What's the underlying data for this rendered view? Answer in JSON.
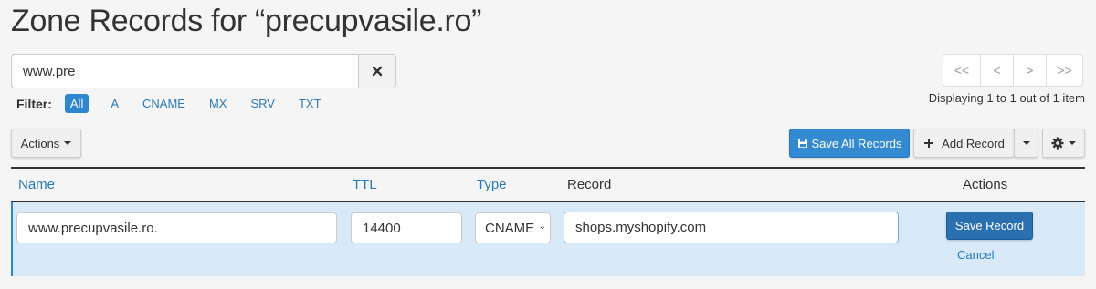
{
  "header": {
    "title": "Zone Records for “precupvasile.ro”"
  },
  "search": {
    "value": "www.pre",
    "clear_icon": "close-icon"
  },
  "pagination": {
    "first": "<<",
    "prev": "<",
    "next": ">",
    "last": ">>",
    "summary": "Displaying 1 to 1 out of 1 item"
  },
  "filter": {
    "label": "Filter:",
    "items": [
      "All",
      "A",
      "CNAME",
      "MX",
      "SRV",
      "TXT"
    ],
    "active": "All"
  },
  "toolbar": {
    "actions_label": "Actions",
    "save_all_label": "Save All Records",
    "save_all_icon": "save-icon",
    "add_record_label": "Add Record",
    "add_record_icon": "plus-icon",
    "settings_icon": "gear-icon"
  },
  "table": {
    "headers": {
      "name": "Name",
      "ttl": "TTL",
      "type": "Type",
      "record": "Record",
      "actions": "Actions"
    },
    "rows": [
      {
        "name": "www.precupvasile.ro.",
        "ttl": "14400",
        "type": "CNAME",
        "record": "shops.myshopify.com",
        "save_label": "Save Record",
        "cancel_label": "Cancel"
      }
    ]
  },
  "colors": {
    "accent": "#338ad1",
    "link": "#2a7ab8",
    "row_highlight": "#d8eaf8"
  }
}
